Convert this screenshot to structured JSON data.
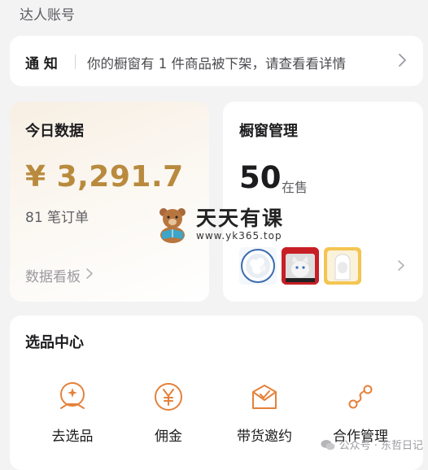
{
  "header": {
    "label": "达人账号"
  },
  "notice": {
    "tag": "通 知",
    "message": "你的橱窗有 1 件商品被下架，请查看看详情"
  },
  "today": {
    "title": "今日数据",
    "amount": "¥ 3,291.7",
    "orders": "81 笔订单",
    "board_label": "数据看板"
  },
  "window": {
    "title": "橱窗管理",
    "count": "50",
    "count_suffix": "在售",
    "products": [
      "product-1",
      "product-2",
      "product-3"
    ]
  },
  "selection_center": {
    "title": "选品中心",
    "items": [
      {
        "label": "去选品",
        "icon": "select-product-icon"
      },
      {
        "label": "佣金",
        "icon": "yen-icon"
      },
      {
        "label": "带货邀约",
        "icon": "invite-mail-icon"
      },
      {
        "label": "合作管理",
        "icon": "cooperation-icon"
      }
    ]
  },
  "watermark": {
    "title": "天天有课",
    "url": "www.yk365.top"
  },
  "footer_watermark": {
    "text": "公众号 · 东哲日记"
  },
  "colors": {
    "accent": "#e5813a",
    "gold": "#b98a3e",
    "background": "#f3f3f4"
  }
}
